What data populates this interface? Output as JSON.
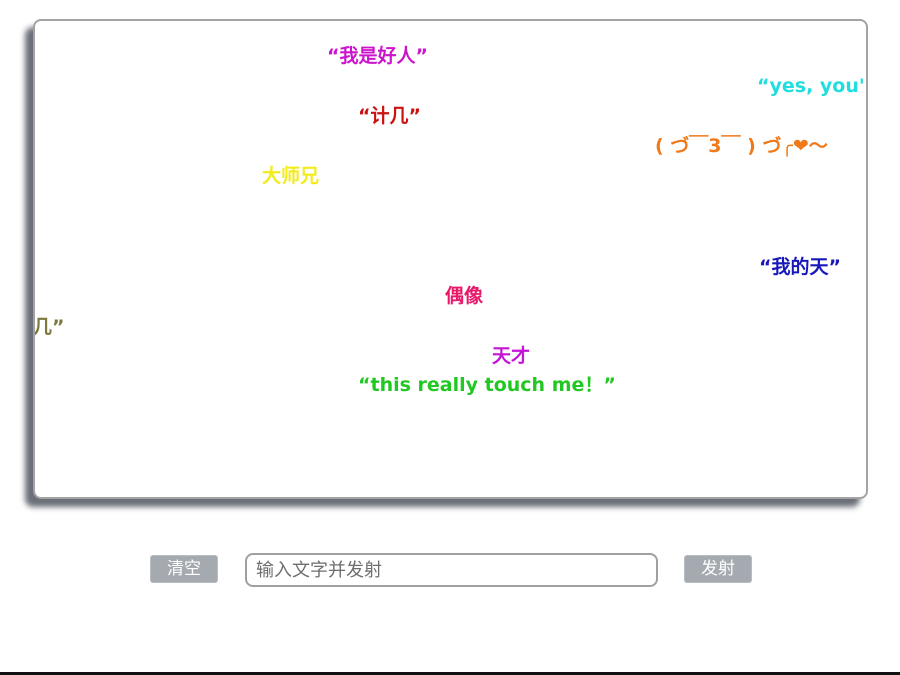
{
  "danmaku": [
    {
      "text": "“我是好人”",
      "color": "#cc14cc"
    },
    {
      "text": "“yes, you're",
      "color": "#22dddd"
    },
    {
      "text": "“计几”",
      "color": "#cc1111"
    },
    {
      "text": "( づ￣3￣ ) づ╭❤～",
      "color": "#f07a1a"
    },
    {
      "text": "大师兄",
      "color": "#f2ec1a"
    },
    {
      "text": "“我的天”",
      "color": "#1818bb"
    },
    {
      "text": "偶像",
      "color": "#e8186a"
    },
    {
      "text": "几”",
      "color": "#7b7a3c"
    },
    {
      "text": "天才",
      "color": "#c414d8"
    },
    {
      "text": "“this really touch me！”",
      "color": "#22c822"
    }
  ],
  "controls": {
    "clear_label": "清空",
    "input_placeholder": "输入文字并发射",
    "input_value": "",
    "fire_label": "发射"
  },
  "colors": {
    "button_bg": "#a5a9b0",
    "screen_border": "#a3a3a3"
  }
}
